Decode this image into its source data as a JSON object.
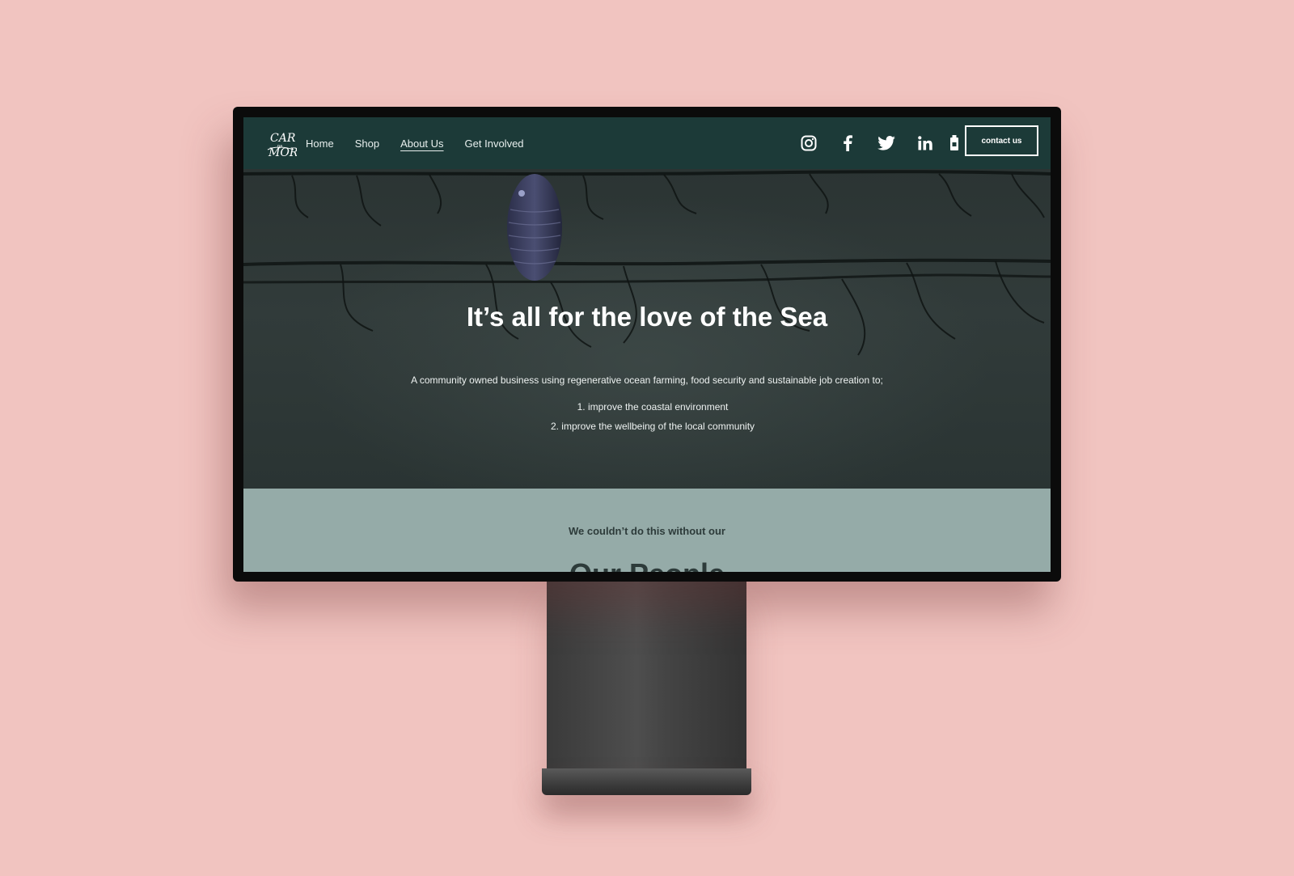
{
  "brand": {
    "logo_alt": "Car Mor",
    "colors": {
      "background": "#f1c4c0",
      "nav": "#1c3a38",
      "hero": "#2f3a39",
      "section": "#95aba8",
      "text_light": "#ffffff",
      "text_dark": "#2d3b3a"
    }
  },
  "nav": {
    "links": [
      {
        "label": "Home",
        "active": false
      },
      {
        "label": "Shop",
        "active": false
      },
      {
        "label": "About Us",
        "active": true
      },
      {
        "label": "Get Involved",
        "active": false
      }
    ],
    "socials": [
      {
        "icon": "instagram-icon"
      },
      {
        "icon": "facebook-icon"
      },
      {
        "icon": "twitter-icon"
      },
      {
        "icon": "linkedin-icon"
      },
      {
        "icon": "bottle-icon"
      }
    ],
    "contact_label": "contact us"
  },
  "hero": {
    "title": "It’s all for the love of the Sea",
    "description": "A community owned business using regenerative ocean farming, food security and sustainable job creation to;",
    "list": [
      "1. improve the coastal environment",
      "2. improve the wellbeing of the local community"
    ]
  },
  "people": {
    "subtitle": "We couldn’t do this without our",
    "title": "Our People"
  }
}
